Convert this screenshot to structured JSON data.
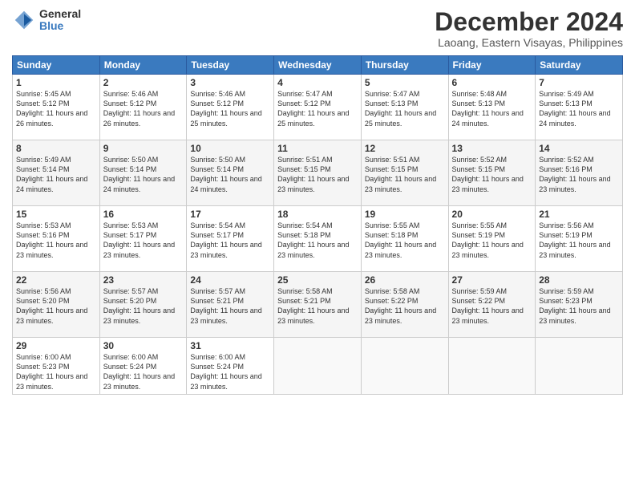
{
  "header": {
    "logo_general": "General",
    "logo_blue": "Blue",
    "month_title": "December 2024",
    "location": "Laoang, Eastern Visayas, Philippines"
  },
  "days_of_week": [
    "Sunday",
    "Monday",
    "Tuesday",
    "Wednesday",
    "Thursday",
    "Friday",
    "Saturday"
  ],
  "weeks": [
    [
      {
        "day": "1",
        "sunrise": "5:45 AM",
        "sunset": "5:12 PM",
        "daylight": "11 hours and 26 minutes."
      },
      {
        "day": "2",
        "sunrise": "5:46 AM",
        "sunset": "5:12 PM",
        "daylight": "11 hours and 26 minutes."
      },
      {
        "day": "3",
        "sunrise": "5:46 AM",
        "sunset": "5:12 PM",
        "daylight": "11 hours and 25 minutes."
      },
      {
        "day": "4",
        "sunrise": "5:47 AM",
        "sunset": "5:12 PM",
        "daylight": "11 hours and 25 minutes."
      },
      {
        "day": "5",
        "sunrise": "5:47 AM",
        "sunset": "5:13 PM",
        "daylight": "11 hours and 25 minutes."
      },
      {
        "day": "6",
        "sunrise": "5:48 AM",
        "sunset": "5:13 PM",
        "daylight": "11 hours and 24 minutes."
      },
      {
        "day": "7",
        "sunrise": "5:49 AM",
        "sunset": "5:13 PM",
        "daylight": "11 hours and 24 minutes."
      }
    ],
    [
      {
        "day": "8",
        "sunrise": "5:49 AM",
        "sunset": "5:14 PM",
        "daylight": "11 hours and 24 minutes."
      },
      {
        "day": "9",
        "sunrise": "5:50 AM",
        "sunset": "5:14 PM",
        "daylight": "11 hours and 24 minutes."
      },
      {
        "day": "10",
        "sunrise": "5:50 AM",
        "sunset": "5:14 PM",
        "daylight": "11 hours and 24 minutes."
      },
      {
        "day": "11",
        "sunrise": "5:51 AM",
        "sunset": "5:15 PM",
        "daylight": "11 hours and 23 minutes."
      },
      {
        "day": "12",
        "sunrise": "5:51 AM",
        "sunset": "5:15 PM",
        "daylight": "11 hours and 23 minutes."
      },
      {
        "day": "13",
        "sunrise": "5:52 AM",
        "sunset": "5:15 PM",
        "daylight": "11 hours and 23 minutes."
      },
      {
        "day": "14",
        "sunrise": "5:52 AM",
        "sunset": "5:16 PM",
        "daylight": "11 hours and 23 minutes."
      }
    ],
    [
      {
        "day": "15",
        "sunrise": "5:53 AM",
        "sunset": "5:16 PM",
        "daylight": "11 hours and 23 minutes."
      },
      {
        "day": "16",
        "sunrise": "5:53 AM",
        "sunset": "5:17 PM",
        "daylight": "11 hours and 23 minutes."
      },
      {
        "day": "17",
        "sunrise": "5:54 AM",
        "sunset": "5:17 PM",
        "daylight": "11 hours and 23 minutes."
      },
      {
        "day": "18",
        "sunrise": "5:54 AM",
        "sunset": "5:18 PM",
        "daylight": "11 hours and 23 minutes."
      },
      {
        "day": "19",
        "sunrise": "5:55 AM",
        "sunset": "5:18 PM",
        "daylight": "11 hours and 23 minutes."
      },
      {
        "day": "20",
        "sunrise": "5:55 AM",
        "sunset": "5:19 PM",
        "daylight": "11 hours and 23 minutes."
      },
      {
        "day": "21",
        "sunrise": "5:56 AM",
        "sunset": "5:19 PM",
        "daylight": "11 hours and 23 minutes."
      }
    ],
    [
      {
        "day": "22",
        "sunrise": "5:56 AM",
        "sunset": "5:20 PM",
        "daylight": "11 hours and 23 minutes."
      },
      {
        "day": "23",
        "sunrise": "5:57 AM",
        "sunset": "5:20 PM",
        "daylight": "11 hours and 23 minutes."
      },
      {
        "day": "24",
        "sunrise": "5:57 AM",
        "sunset": "5:21 PM",
        "daylight": "11 hours and 23 minutes."
      },
      {
        "day": "25",
        "sunrise": "5:58 AM",
        "sunset": "5:21 PM",
        "daylight": "11 hours and 23 minutes."
      },
      {
        "day": "26",
        "sunrise": "5:58 AM",
        "sunset": "5:22 PM",
        "daylight": "11 hours and 23 minutes."
      },
      {
        "day": "27",
        "sunrise": "5:59 AM",
        "sunset": "5:22 PM",
        "daylight": "11 hours and 23 minutes."
      },
      {
        "day": "28",
        "sunrise": "5:59 AM",
        "sunset": "5:23 PM",
        "daylight": "11 hours and 23 minutes."
      }
    ],
    [
      {
        "day": "29",
        "sunrise": "6:00 AM",
        "sunset": "5:23 PM",
        "daylight": "11 hours and 23 minutes."
      },
      {
        "day": "30",
        "sunrise": "6:00 AM",
        "sunset": "5:24 PM",
        "daylight": "11 hours and 23 minutes."
      },
      {
        "day": "31",
        "sunrise": "6:00 AM",
        "sunset": "5:24 PM",
        "daylight": "11 hours and 23 minutes."
      },
      null,
      null,
      null,
      null
    ]
  ]
}
